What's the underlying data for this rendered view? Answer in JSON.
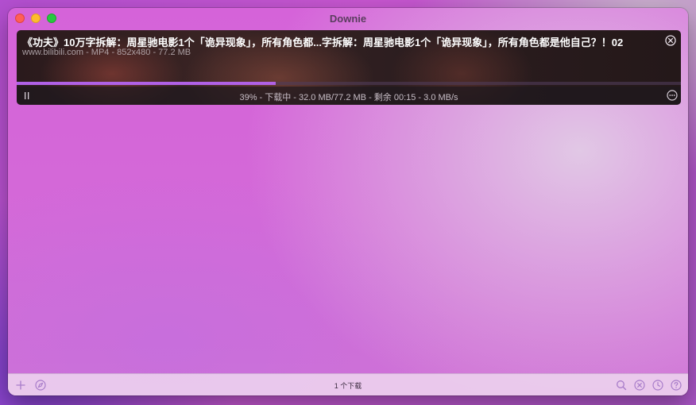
{
  "window": {
    "title": "Downie"
  },
  "download": {
    "title": "《功夫》10万字拆解：周星驰电影1个「诡异现象」，所有角色都...字拆解：周星驰电影1个「诡异现象」，所有角色都是他自己？！02",
    "meta": "www.bilibili.com - MP4 - 852x480 - 77.2 MB",
    "progress_percent": 39,
    "status": "39% - 下载中 - 32.0 MB/77.2 MB - 剩余 00:15 - 3.0 MB/s"
  },
  "footer": {
    "count_label": "1 个下载"
  },
  "icons": {
    "add": "plus-icon",
    "browser": "compass-icon",
    "search": "search-icon",
    "clear": "x-circle-icon",
    "history": "clock-icon",
    "help": "question-icon",
    "remove": "x-circle-icon",
    "pause": "pause-icon",
    "more": "ellipsis-circle-icon"
  },
  "colors": {
    "accent": "#b061e6",
    "icon": "#a77cc9"
  }
}
